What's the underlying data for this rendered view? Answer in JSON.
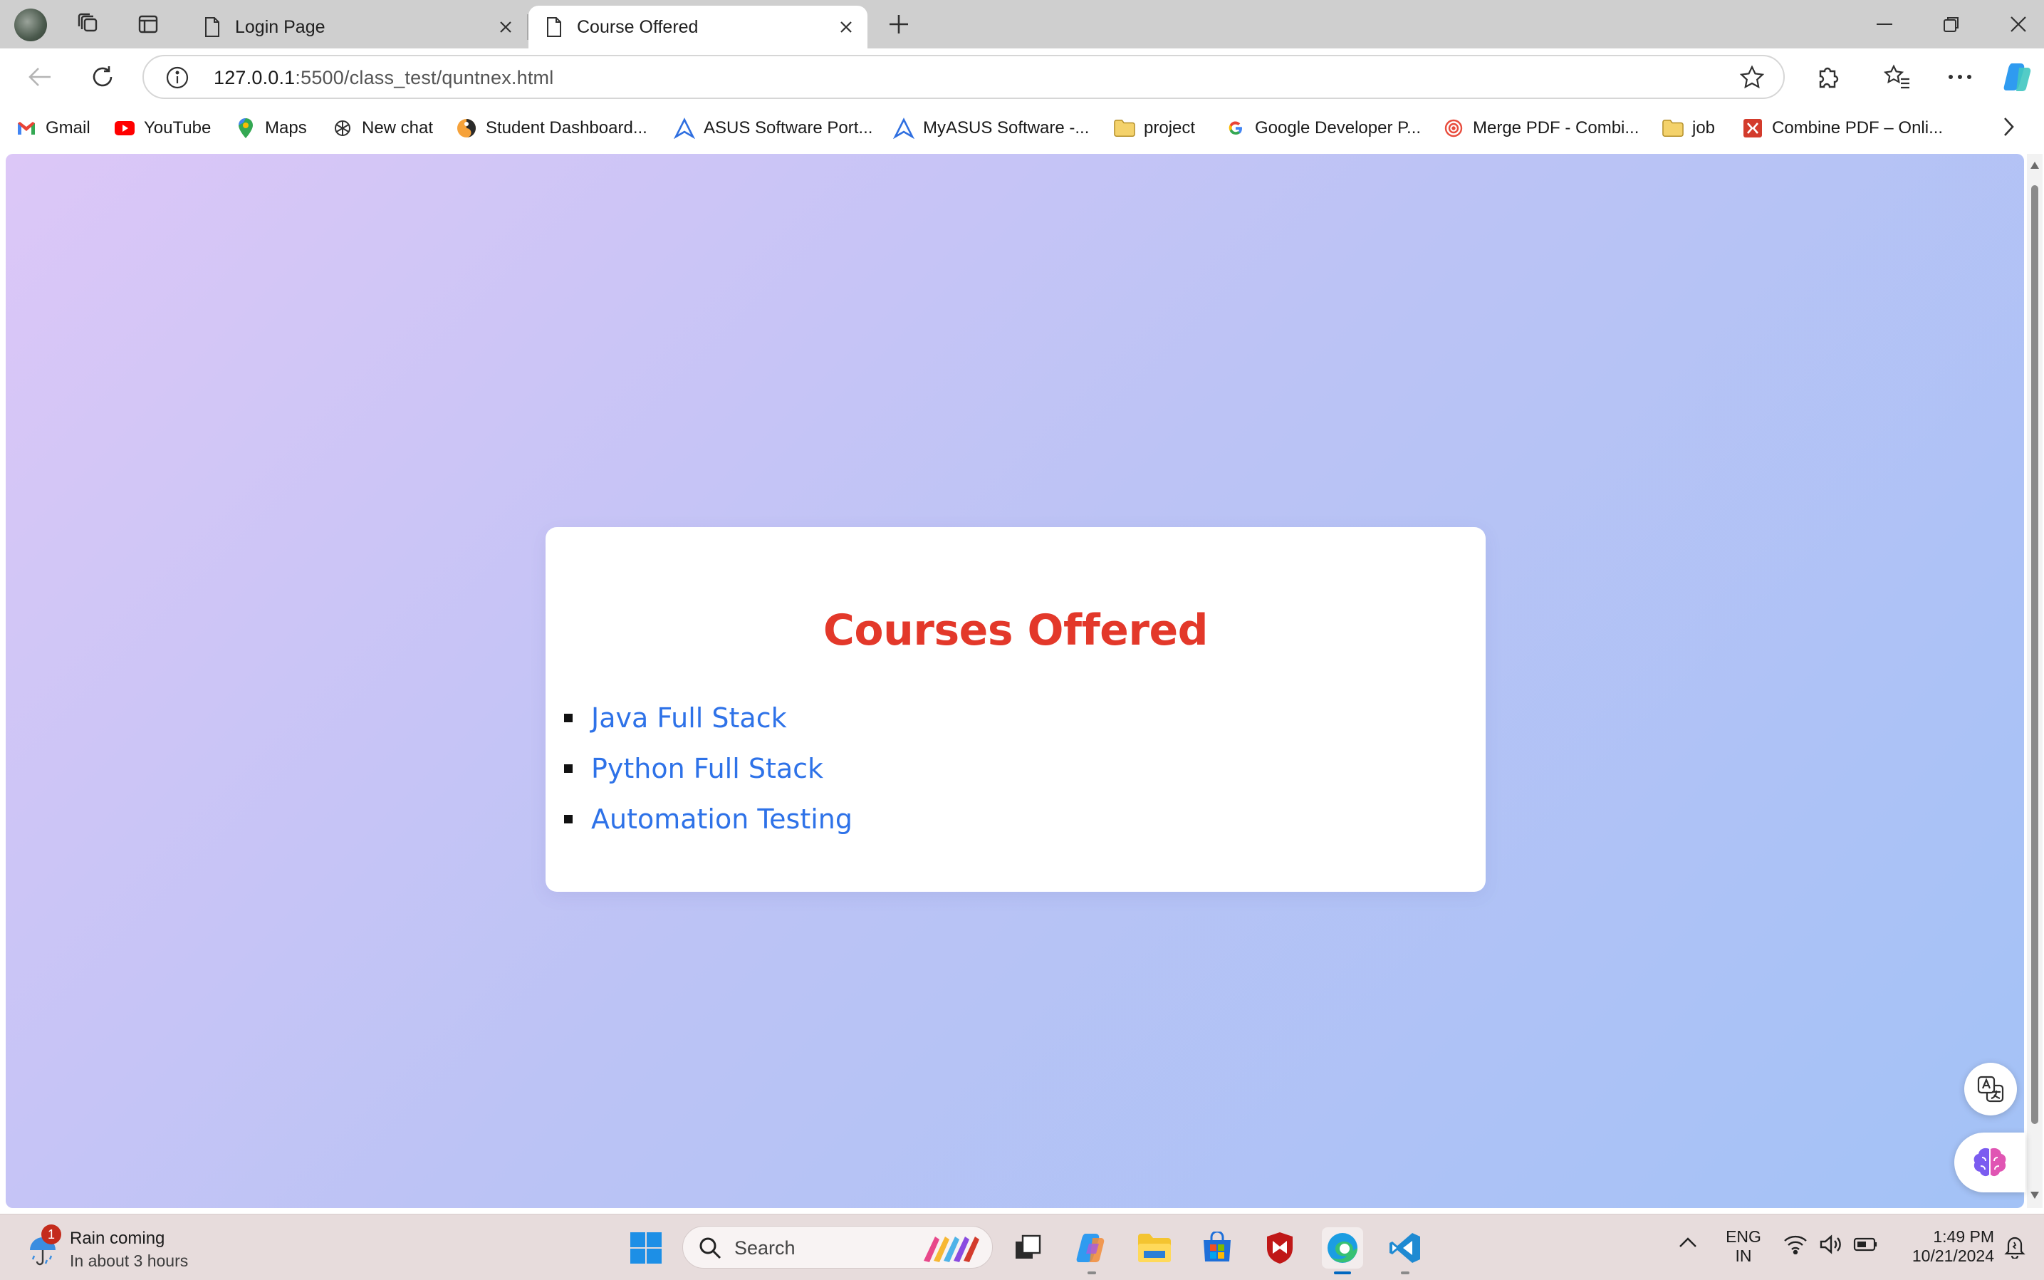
{
  "browser": {
    "tabs": [
      {
        "label": "Login Page",
        "active": false
      },
      {
        "label": "Course Offered",
        "active": true
      }
    ],
    "address": {
      "host": "127.0.0.1",
      "rest": ":5500/class_test/quntnex.html"
    },
    "bookmarks": [
      {
        "label": "Gmail",
        "icon": "gmail-icon"
      },
      {
        "label": "YouTube",
        "icon": "youtube-icon"
      },
      {
        "label": "Maps",
        "icon": "maps-icon"
      },
      {
        "label": "New chat",
        "icon": "openai-icon"
      },
      {
        "label": "Student Dashboard...",
        "icon": "student-icon"
      },
      {
        "label": "ASUS Software Port...",
        "icon": "asus-icon"
      },
      {
        "label": "MyASUS Software -...",
        "icon": "asus-icon"
      },
      {
        "label": "project",
        "icon": "folder-icon"
      },
      {
        "label": "Google Developer P...",
        "icon": "google-icon"
      },
      {
        "label": "Merge PDF - Combi...",
        "icon": "pdf-merge-icon"
      },
      {
        "label": "job",
        "icon": "folder-icon"
      },
      {
        "label": "Combine PDF – Onli...",
        "icon": "pdf-combine-icon"
      }
    ]
  },
  "page": {
    "heading": "Courses Offered",
    "courses": [
      "Java Full Stack",
      "Python Full Stack",
      "Automation Testing"
    ],
    "heading_color": "#e3382a",
    "link_color": "#2e72e8"
  },
  "taskbar": {
    "weather": {
      "badge": "1",
      "title": "Rain coming",
      "subtitle": "In about 3 hours"
    },
    "search_placeholder": "Search",
    "language": {
      "line1": "ENG",
      "line2": "IN"
    },
    "clock": {
      "time": "1:49 PM",
      "date": "10/21/2024"
    }
  }
}
